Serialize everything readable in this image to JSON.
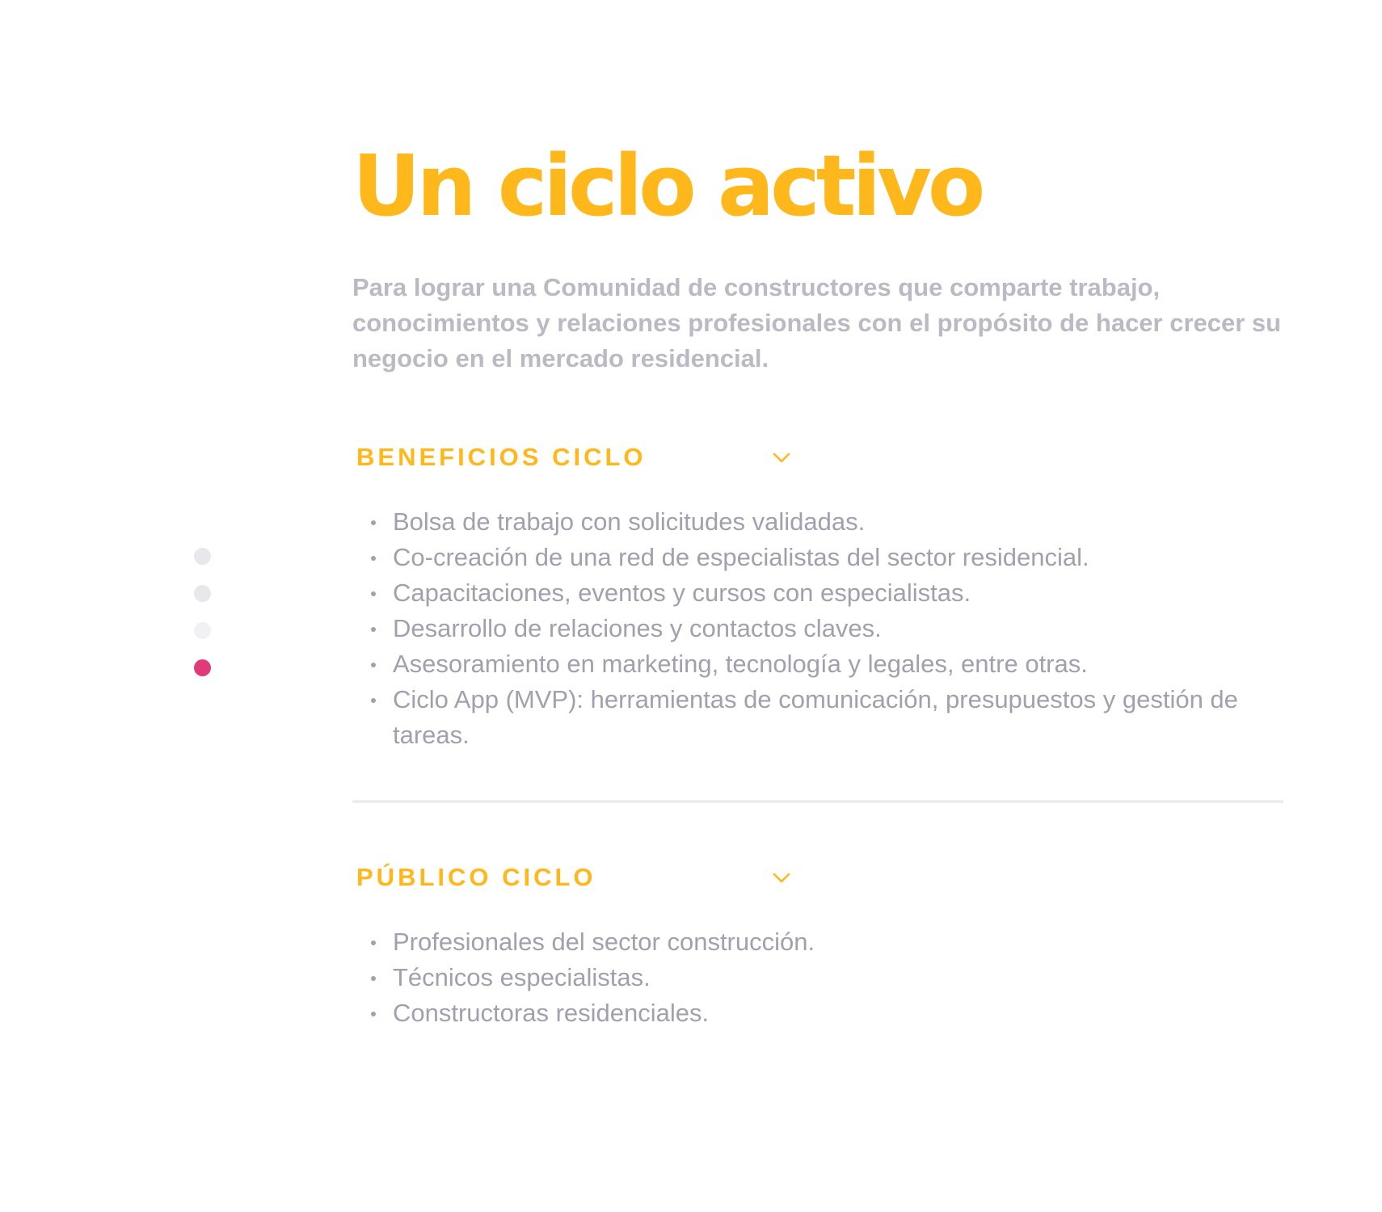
{
  "header": {
    "title": "Un ciclo activo",
    "intro": "Para lograr una Comunidad de constructores que comparte trabajo, conocimientos y relaciones profesionales con el propósito de hacer crecer su negocio en el mercado residencial."
  },
  "colors": {
    "accent": "#ffb81c",
    "body_text": "#a2a0ae",
    "intro_text": "#bab9c4",
    "active_dot": "#e23a78",
    "inactive_dot": "#e8e8eb",
    "divider": "#ededf0"
  },
  "pagination": {
    "count": 4,
    "active_index": 3
  },
  "sections": [
    {
      "title": "BENEFICIOS CICLO",
      "icon": "chevron-down-icon",
      "items": [
        "Bolsa de trabajo con solicitudes validadas.",
        "Co-creación de una red de especialistas del sector residencial.",
        "Capacitaciones, eventos y cursos con especialistas.",
        "Desarrollo de relaciones y contactos claves.",
        "Asesoramiento en marketing, tecnología y legales, entre otras.",
        "Ciclo App (MVP): herramientas de comunicación, presupuestos y gestión de tareas."
      ]
    },
    {
      "title": "PÚBLICO CICLO",
      "icon": "chevron-down-icon",
      "items": [
        "Profesionales del sector construcción.",
        "Técnicos especialistas.",
        "Constructoras residenciales."
      ]
    }
  ]
}
